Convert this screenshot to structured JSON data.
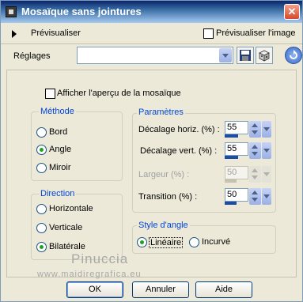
{
  "window": {
    "title": "Mosaïque sans jointures",
    "close_glyph": "✕"
  },
  "preview_bar": {
    "label": "Prévisualiser",
    "image_checkbox_label": "Prévisualiser l'image"
  },
  "presets": {
    "label": "Réglages",
    "value": ""
  },
  "options": {
    "show_preview_label": "Afficher l'aperçu de la mosaïque"
  },
  "method": {
    "title": "Méthode",
    "options": [
      "Bord",
      "Angle",
      "Miroir"
    ],
    "selected": "Angle"
  },
  "direction": {
    "title": "Direction",
    "options": [
      "Horizontale",
      "Verticale",
      "Bilatérale"
    ],
    "selected": "Bilatérale"
  },
  "parameters": {
    "title": "Paramètres",
    "fields": [
      {
        "label": "Décalage horiz. (%) :",
        "value": "55",
        "fill": 0.55,
        "enabled": true
      },
      {
        "label": "Décalage vert. (%) :",
        "value": "55",
        "fill": 0.55,
        "enabled": true
      },
      {
        "label": "Largeur (%) :",
        "value": "50",
        "fill": 0.5,
        "enabled": false
      },
      {
        "label": "Transition (%) :",
        "value": "50",
        "fill": 0.5,
        "enabled": true
      }
    ]
  },
  "corner_style": {
    "title": "Style d'angle",
    "options": [
      "Linéaire",
      "Incurvé"
    ],
    "selected": "Linéaire"
  },
  "watermark": {
    "name": "Pinuccia",
    "site": "www.maidiregrafica.eu"
  },
  "buttons": {
    "ok": "OK",
    "cancel": "Annuler",
    "help": "Aide"
  },
  "colors": {
    "titlebar": "#0a246a",
    "group_title": "#0046d5",
    "background": "#ece9d8",
    "radio_dot": "#21a121"
  },
  "icons": [
    "app-icon",
    "close-icon",
    "expand-triangle-icon",
    "save-icon",
    "dice-icon",
    "reset-icon"
  ]
}
